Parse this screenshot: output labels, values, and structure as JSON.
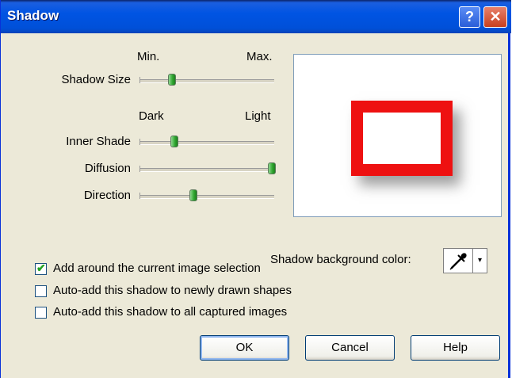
{
  "window": {
    "title": "Shadow",
    "help_label": "?",
    "close_label": "✕"
  },
  "sliders": {
    "size_range": {
      "min": "Min.",
      "max": "Max."
    },
    "shade_range": {
      "min": "Dark",
      "max": "Light"
    },
    "shadow_size": {
      "label": "Shadow Size",
      "value": 0.24
    },
    "inner_shade": {
      "label": "Inner Shade",
      "value": 0.26
    },
    "diffusion": {
      "label": "Diffusion",
      "value": 0.98
    },
    "direction": {
      "label": "Direction",
      "value": 0.4
    }
  },
  "preview": {
    "shape_color": "#ee1111"
  },
  "background_color": {
    "label": "Shadow background color:",
    "icon": "eyedropper-icon",
    "arrow": "▾"
  },
  "checkboxes": [
    {
      "label": "Add around the current image selection",
      "checked": true
    },
    {
      "label": "Auto-add this shadow to newly drawn shapes",
      "checked": false
    },
    {
      "label": "Auto-add this shadow to all captured images",
      "checked": false
    }
  ],
  "buttons": {
    "ok": "OK",
    "cancel": "Cancel",
    "help": "Help"
  }
}
